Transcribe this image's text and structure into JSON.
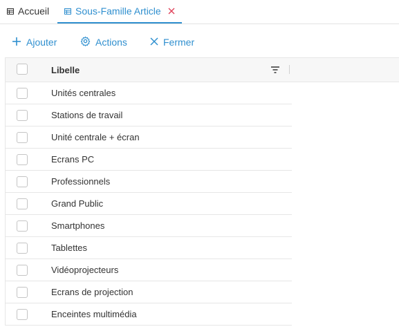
{
  "tabs": {
    "home": {
      "label": "Accueil",
      "icon": "list-icon"
    },
    "active": {
      "label": "Sous-Famille Article",
      "icon": "list-icon",
      "close_icon": "close-icon",
      "close_color": "#e0435a"
    }
  },
  "toolbar": {
    "add_label": "Ajouter",
    "actions_label": "Actions",
    "close_label": "Fermer",
    "accent_color": "#2f8fcf"
  },
  "grid": {
    "columns": [
      {
        "header": "Libelle",
        "filter_icon": "filter-icon"
      }
    ],
    "rows": [
      {
        "label": "Unités centrales"
      },
      {
        "label": "Stations de travail"
      },
      {
        "label": "Unité centrale + écran"
      },
      {
        "label": "Ecrans PC"
      },
      {
        "label": "Professionnels"
      },
      {
        "label": "Grand Public"
      },
      {
        "label": "Smartphones"
      },
      {
        "label": "Tablettes"
      },
      {
        "label": "Vidéoprojecteurs"
      },
      {
        "label": "Ecrans de projection"
      },
      {
        "label": "Enceintes multimédia"
      }
    ]
  }
}
